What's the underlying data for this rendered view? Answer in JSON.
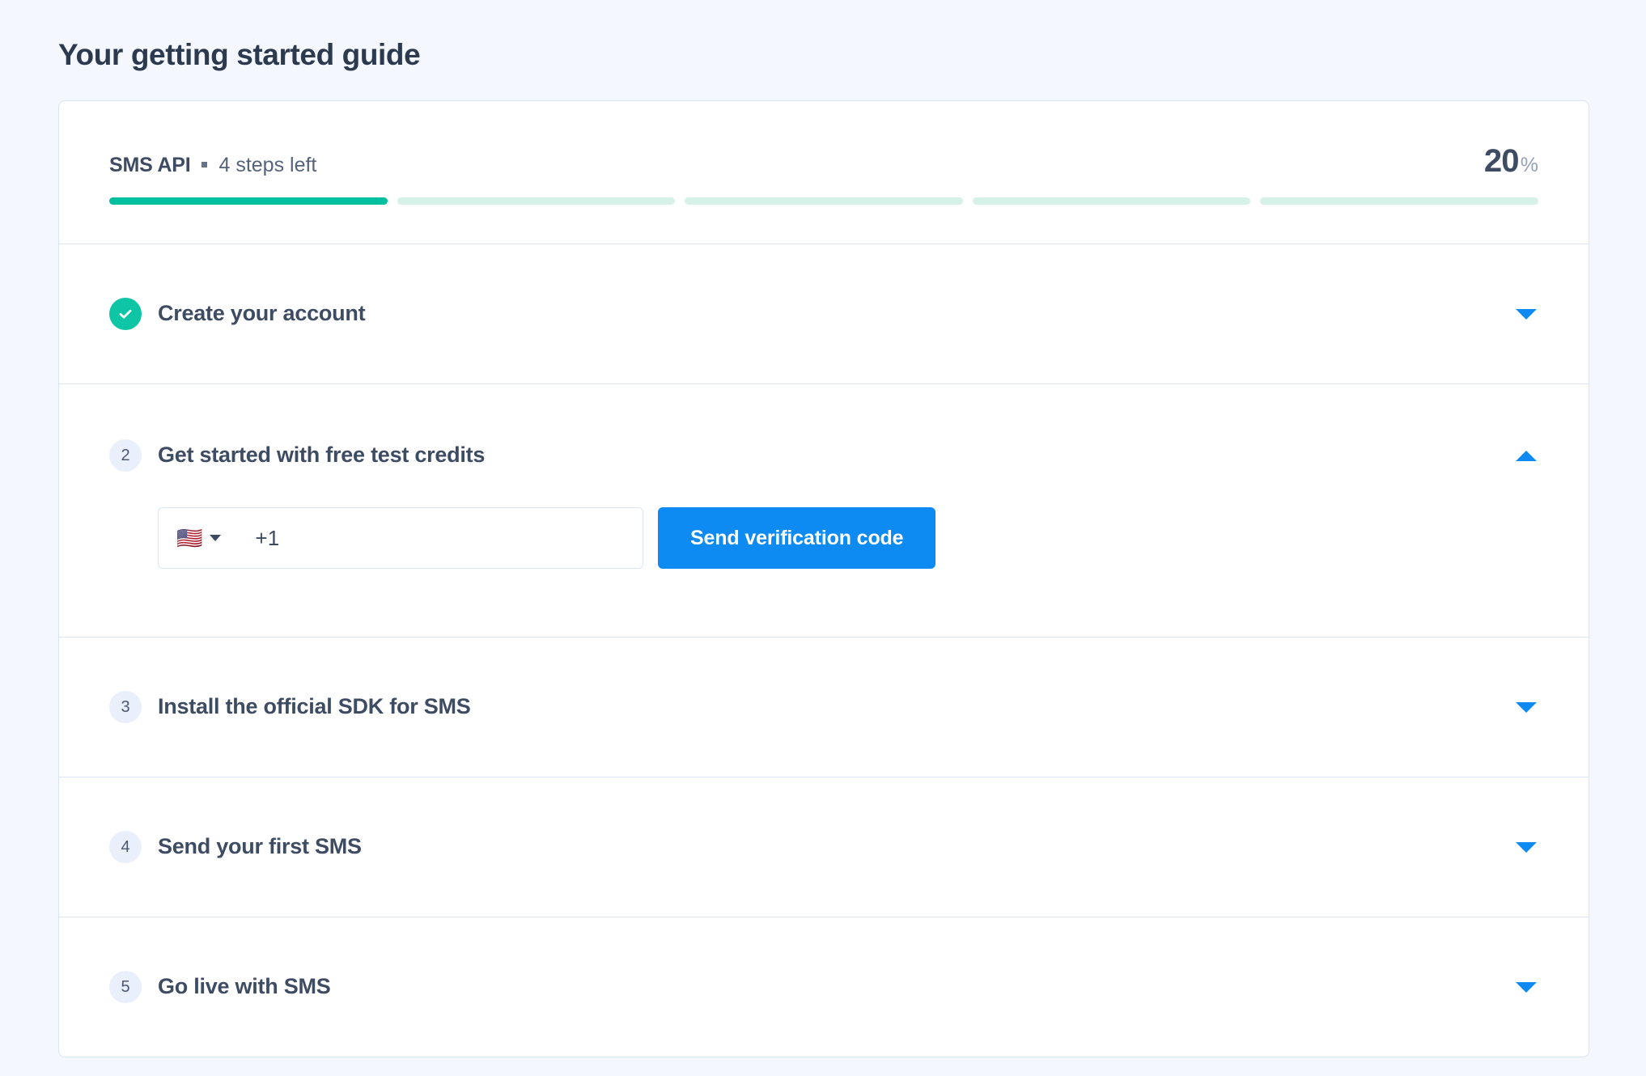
{
  "page": {
    "title": "Your getting started guide",
    "background_color": "#f4f7fd"
  },
  "progress": {
    "track_name": "SMS API",
    "steps_left_label": "4 steps left",
    "percent_value": "20",
    "percent_sign": "%",
    "segments_total": 5,
    "segments_filled": 1,
    "filled_color": "#00bfa0",
    "empty_color": "#d6f2e8"
  },
  "steps": [
    {
      "marker_type": "check",
      "marker_label": "",
      "title": "Create your account",
      "chevron": "chevron-down",
      "expanded": false
    },
    {
      "marker_type": "number",
      "marker_label": "2",
      "title": "Get started with free test credits",
      "chevron": "chevron-up",
      "expanded": true
    },
    {
      "marker_type": "number",
      "marker_label": "3",
      "title": "Install the official SDK for SMS",
      "chevron": "chevron-down",
      "expanded": false
    },
    {
      "marker_type": "number",
      "marker_label": "4",
      "title": "Send your first SMS",
      "chevron": "chevron-down",
      "expanded": false
    },
    {
      "marker_type": "number",
      "marker_label": "5",
      "title": "Go live with SMS",
      "chevron": "chevron-down",
      "expanded": false
    }
  ],
  "verification": {
    "country_flag": "🇺🇸",
    "country_caret": "chevron-down-icon",
    "dial_code": "+1",
    "phone_placeholder": "",
    "send_button_label": "Send verification code",
    "button_color": "#0d8bf2"
  }
}
